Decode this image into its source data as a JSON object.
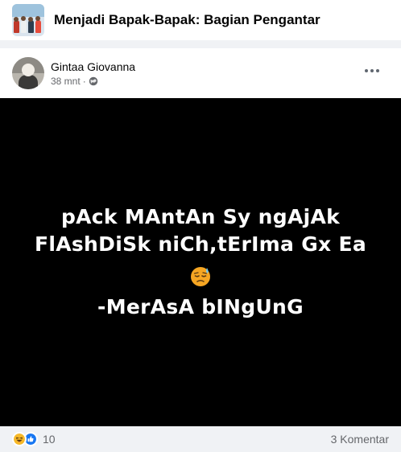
{
  "group": {
    "title": "Menjadi Bapak-Bapak: Bagian Pengantar",
    "thumbnail_icon": "group-photo-thumbnail"
  },
  "post": {
    "author": "Gintaa Giovanna",
    "time": "38 mnt",
    "separator": "·",
    "privacy_icon": "globe-icon",
    "more_icon": "more-horizontal-icon",
    "image_text": {
      "line1": "pAck MAntAn Sy ngAjAk",
      "line2": "FlAshDiSk niCh,tErIma Gx Ea",
      "emoji": "downcast-face-with-sweat-icon",
      "line3": "-MerAsA bINgUnG"
    }
  },
  "footer": {
    "reaction_icons": [
      "haha-icon",
      "like-icon"
    ],
    "reaction_count": "10",
    "comments": "3 Komentar"
  },
  "colors": {
    "text_primary": "#050505",
    "text_secondary": "#65676b",
    "like_blue": "#1877f2",
    "haha_yellow": "#f7b928"
  }
}
